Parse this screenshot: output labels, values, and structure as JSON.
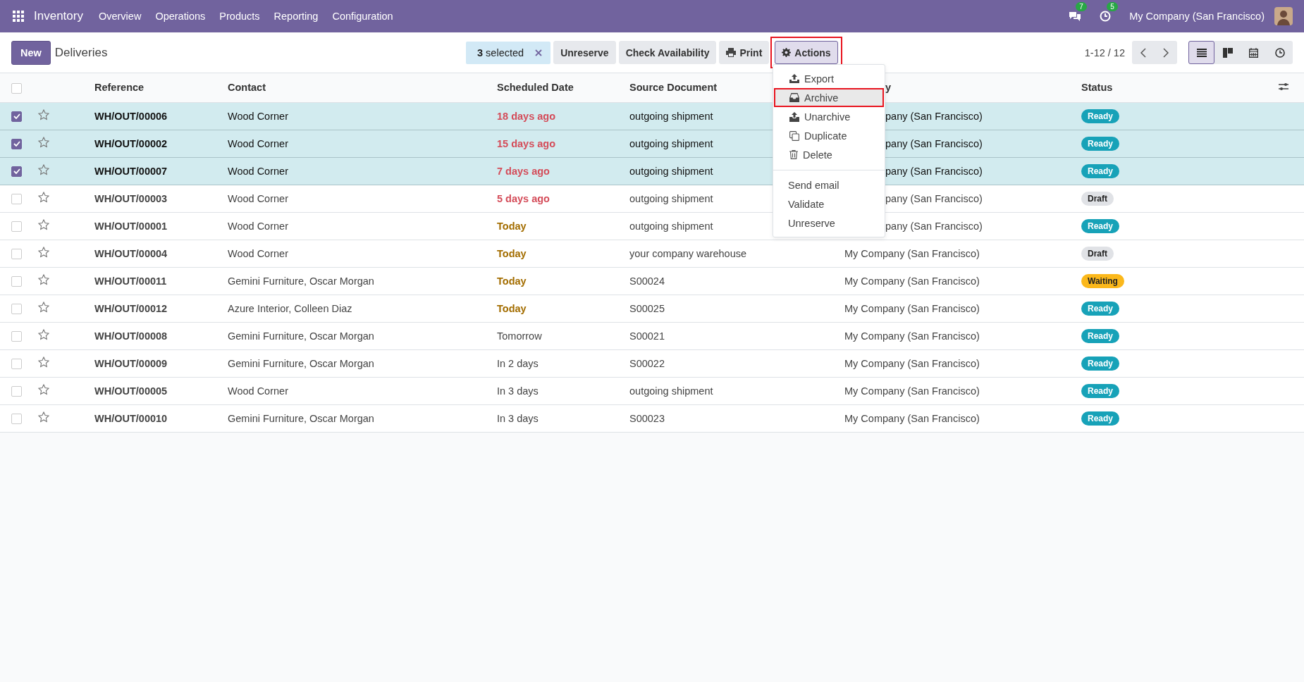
{
  "navbar": {
    "app": "Inventory",
    "menus": [
      "Overview",
      "Operations",
      "Products",
      "Reporting",
      "Configuration"
    ],
    "messages_count": "7",
    "activities_count": "5",
    "company": "My Company (San Francisco)"
  },
  "control_panel": {
    "new_button": "New",
    "title": "Deliveries",
    "selection": {
      "count": "3",
      "label": "selected"
    },
    "buttons": [
      "Unreserve",
      "Check Availability"
    ],
    "print": "Print",
    "actions": {
      "label": "Actions",
      "highlighted": true
    },
    "pager": "1-12 / 12",
    "views": [
      {
        "kind": "list",
        "selected": true
      },
      {
        "kind": "kanban",
        "selected": false
      },
      {
        "kind": "calendar",
        "selected": false
      },
      {
        "kind": "activity",
        "selected": false
      }
    ]
  },
  "actions_menu": {
    "items": [
      {
        "label": "Export",
        "highlighted": false
      },
      {
        "label": "Archive",
        "highlighted": true
      },
      {
        "label": "Unarchive",
        "highlighted": false
      },
      {
        "label": "Duplicate",
        "highlighted": false
      },
      {
        "label": "Delete",
        "highlighted": false
      }
    ],
    "other_items": [
      "Send email",
      "Validate",
      "Unreserve"
    ]
  },
  "table": {
    "select_all_checked": false,
    "columns": [
      {
        "label": "Reference"
      },
      {
        "label": "Contact"
      },
      {
        "label": "Scheduled Date"
      },
      {
        "label": "Source Document"
      },
      {
        "label": "y",
        "partly_hidden": true
      },
      {
        "label": "Status"
      }
    ],
    "rows": [
      {
        "selected": true,
        "reference": "WH/OUT/00006",
        "contact": "Wood Corner",
        "date": {
          "text": "18 days ago",
          "kind": "late"
        },
        "source": "outgoing shipment",
        "company": "pany (San Francisco)",
        "company_partly_hidden": true,
        "status": {
          "text": "Ready",
          "kind": "ready"
        }
      },
      {
        "selected": true,
        "reference": "WH/OUT/00002",
        "contact": "Wood Corner",
        "date": {
          "text": "15 days ago",
          "kind": "late"
        },
        "source": "outgoing shipment",
        "company": "pany (San Francisco)",
        "company_partly_hidden": true,
        "status": {
          "text": "Ready",
          "kind": "ready"
        }
      },
      {
        "selected": true,
        "reference": "WH/OUT/00007",
        "contact": "Wood Corner",
        "date": {
          "text": "7 days ago",
          "kind": "late"
        },
        "source": "outgoing shipment",
        "company": "pany (San Francisco)",
        "company_partly_hidden": true,
        "status": {
          "text": "Ready",
          "kind": "ready"
        }
      },
      {
        "selected": false,
        "reference": "WH/OUT/00003",
        "contact": "Wood Corner",
        "date": {
          "text": "5 days ago",
          "kind": "late"
        },
        "source": "outgoing shipment",
        "company": "pany (San Francisco)",
        "company_partly_hidden": true,
        "status": {
          "text": "Draft",
          "kind": "draft"
        }
      },
      {
        "selected": false,
        "reference": "WH/OUT/00001",
        "contact": "Wood Corner",
        "date": {
          "text": "Today",
          "kind": "today"
        },
        "source": "outgoing shipment",
        "company": "pany (San Francisco)",
        "company_partly_hidden": true,
        "status": {
          "text": "Ready",
          "kind": "ready"
        }
      },
      {
        "selected": false,
        "reference": "WH/OUT/00004",
        "contact": "Wood Corner",
        "date": {
          "text": "Today",
          "kind": "today"
        },
        "source": "your company warehouse",
        "company": "My Company (San Francisco)",
        "status": {
          "text": "Draft",
          "kind": "draft"
        }
      },
      {
        "selected": false,
        "reference": "WH/OUT/00011",
        "contact": "Gemini Furniture, Oscar Morgan",
        "date": {
          "text": "Today",
          "kind": "today"
        },
        "source": "S00024",
        "company": "My Company (San Francisco)",
        "status": {
          "text": "Waiting",
          "kind": "waiting"
        }
      },
      {
        "selected": false,
        "reference": "WH/OUT/00012",
        "contact": "Azure Interior, Colleen Diaz",
        "date": {
          "text": "Today",
          "kind": "today"
        },
        "source": "S00025",
        "company": "My Company (San Francisco)",
        "status": {
          "text": "Ready",
          "kind": "ready"
        }
      },
      {
        "selected": false,
        "reference": "WH/OUT/00008",
        "contact": "Gemini Furniture, Oscar Morgan",
        "date": {
          "text": "Tomorrow",
          "kind": "future"
        },
        "source": "S00021",
        "company": "My Company (San Francisco)",
        "status": {
          "text": "Ready",
          "kind": "ready"
        }
      },
      {
        "selected": false,
        "reference": "WH/OUT/00009",
        "contact": "Gemini Furniture, Oscar Morgan",
        "date": {
          "text": "In 2 days",
          "kind": "future"
        },
        "source": "S00022",
        "company": "My Company (San Francisco)",
        "status": {
          "text": "Ready",
          "kind": "ready"
        }
      },
      {
        "selected": false,
        "reference": "WH/OUT/00005",
        "contact": "Wood Corner",
        "date": {
          "text": "In 3 days",
          "kind": "future"
        },
        "source": "outgoing shipment",
        "company": "My Company (San Francisco)",
        "status": {
          "text": "Ready",
          "kind": "ready"
        }
      },
      {
        "selected": false,
        "reference": "WH/OUT/00010",
        "contact": "Gemini Furniture, Oscar Morgan",
        "date": {
          "text": "In 3 days",
          "kind": "future"
        },
        "source": "S00023",
        "company": "My Company (San Francisco)",
        "status": {
          "text": "Ready",
          "kind": "ready"
        }
      }
    ]
  }
}
